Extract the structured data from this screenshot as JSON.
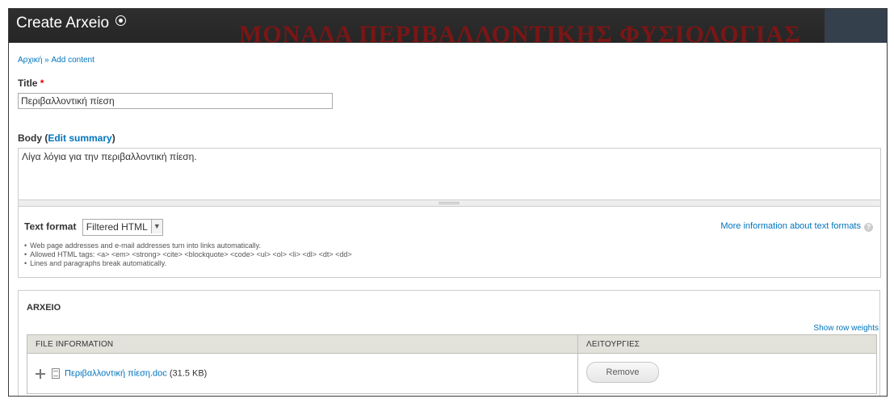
{
  "overlay": {
    "title": "Create Arxeio",
    "background_banner": "ΜΟΝΑΔΑ ΠΕΡΙΒΑΛΛΟΝΤΙΚΗΣ ΦΥΣΙΟΛΟΓΙΑΣ"
  },
  "breadcrumb": {
    "home": "Αρχική",
    "separator": " » ",
    "current": "Add content"
  },
  "title_field": {
    "label": "Title",
    "required_mark": "*",
    "value": "Περιβαλλοντική πίεση"
  },
  "body_field": {
    "label": "Body",
    "open_paren": " (",
    "summary_link": "Edit summary",
    "close_paren": ")",
    "value": "Λίγα λόγια για την περιβαλλοντική πίεση."
  },
  "text_format": {
    "label": "Text format",
    "selected": "Filtered HTML",
    "more_info": "More information about text formats",
    "tips": [
      "Web page addresses and e-mail addresses turn into links automatically.",
      "Allowed HTML tags: <a> <em> <strong> <cite> <blockquote> <code> <ul> <ol> <li> <dl> <dt> <dd>",
      "Lines and paragraphs break automatically."
    ]
  },
  "file_fieldset": {
    "legend": "ARXEIO",
    "show_row_weights": "Show row weights",
    "columns": [
      "FILE INFORMATION",
      "ΛΕΙΤΟΥΡΓΙΕΣ"
    ],
    "rows": [
      {
        "file_name": "Περιβαλλοντική πίεση.doc",
        "file_size": "(31.5 KB)",
        "action": "Remove"
      }
    ]
  },
  "colors": {
    "link": "#0074bd",
    "required": "#e00000",
    "titlebar": "#2a2a2a",
    "table_header": "#e2e2db"
  }
}
